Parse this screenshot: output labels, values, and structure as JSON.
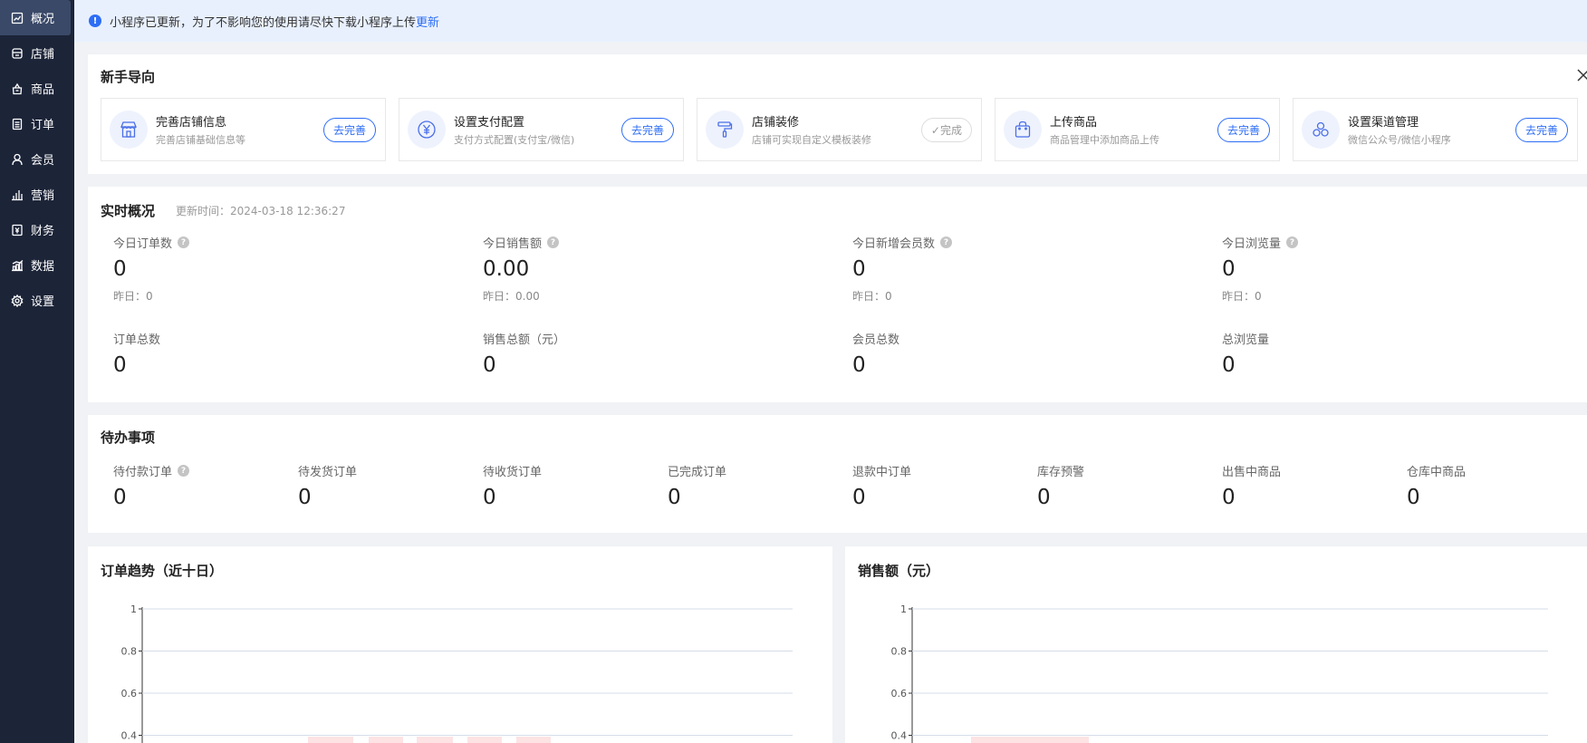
{
  "sidebar": {
    "items": [
      {
        "label": "概况",
        "icon": "chart-icon",
        "active": true
      },
      {
        "label": "店铺",
        "icon": "store-icon"
      },
      {
        "label": "商品",
        "icon": "bag-icon"
      },
      {
        "label": "订单",
        "icon": "document-icon"
      },
      {
        "label": "会员",
        "icon": "user-icon"
      },
      {
        "label": "营销",
        "icon": "bar-chart-icon"
      },
      {
        "label": "财务",
        "icon": "ledger-icon"
      },
      {
        "label": "数据",
        "icon": "data-icon"
      },
      {
        "label": "设置",
        "icon": "gear-icon"
      }
    ]
  },
  "notice": {
    "text": "小程序已更新，为了不影响您的使用请尽快下载小程序上传",
    "link": "更新"
  },
  "guide": {
    "title": "新手导向",
    "items": [
      {
        "title": "完善店铺信息",
        "desc": "完善店铺基础信息等",
        "button": "去完善",
        "done": false,
        "icon": "store-icon"
      },
      {
        "title": "设置支付配置",
        "desc": "支付方式配置(支付宝/微信)",
        "button": "去完善",
        "done": false,
        "icon": "yen-icon"
      },
      {
        "title": "店铺装修",
        "desc": "店铺可实现自定义模板装修",
        "button": "完成",
        "done": true,
        "icon": "paint-roller-icon"
      },
      {
        "title": "上传商品",
        "desc": "商品管理中添加商品上传",
        "button": "去完善",
        "done": false,
        "icon": "shopping-bag-icon"
      },
      {
        "title": "设置渠道管理",
        "desc": "微信公众号/微信小程序",
        "button": "去完善",
        "done": false,
        "icon": "channels-icon"
      }
    ]
  },
  "realtime": {
    "title": "实时概况",
    "update_time": "更新时间：2024-03-18 12:36:27",
    "today": [
      {
        "label": "今日订单数",
        "value": "0",
        "yesterday": "昨日：0"
      },
      {
        "label": "今日销售额",
        "value": "0.00",
        "yesterday": "昨日：0.00"
      },
      {
        "label": "今日新增会员数",
        "value": "0",
        "yesterday": "昨日：0"
      },
      {
        "label": "今日浏览量",
        "value": "0",
        "yesterday": "昨日：0"
      }
    ],
    "totals": [
      {
        "label": "订单总数",
        "value": "0"
      },
      {
        "label": "销售总额（元）",
        "value": "0"
      },
      {
        "label": "会员总数",
        "value": "0"
      },
      {
        "label": "总浏览量",
        "value": "0"
      }
    ]
  },
  "todo": {
    "title": "待办事项",
    "items": [
      {
        "label": "待付款订单",
        "value": "0",
        "help": true
      },
      {
        "label": "待发货订单",
        "value": "0"
      },
      {
        "label": "待收货订单",
        "value": "0"
      },
      {
        "label": "已完成订单",
        "value": "0"
      },
      {
        "label": "退款中订单",
        "value": "0"
      },
      {
        "label": "库存预警",
        "value": "0"
      },
      {
        "label": "出售中商品",
        "value": "0"
      },
      {
        "label": "仓库中商品",
        "value": "0"
      }
    ]
  },
  "chart_data": [
    {
      "type": "line",
      "title": "订单趋势（近十日）",
      "y_ticks": [
        "1",
        "0.8",
        "0.6",
        "0.4"
      ],
      "ylim": [
        0,
        1
      ],
      "grid": true,
      "series": []
    },
    {
      "type": "line",
      "title": "销售额（元）",
      "y_ticks": [
        "1",
        "0.8",
        "0.6",
        "0.4"
      ],
      "ylim": [
        0,
        1
      ],
      "grid": true,
      "series": []
    }
  ],
  "colors": {
    "accent": "#2d6df6",
    "sidebar": "#1c2438",
    "sidebar_active": "#3a4968"
  }
}
